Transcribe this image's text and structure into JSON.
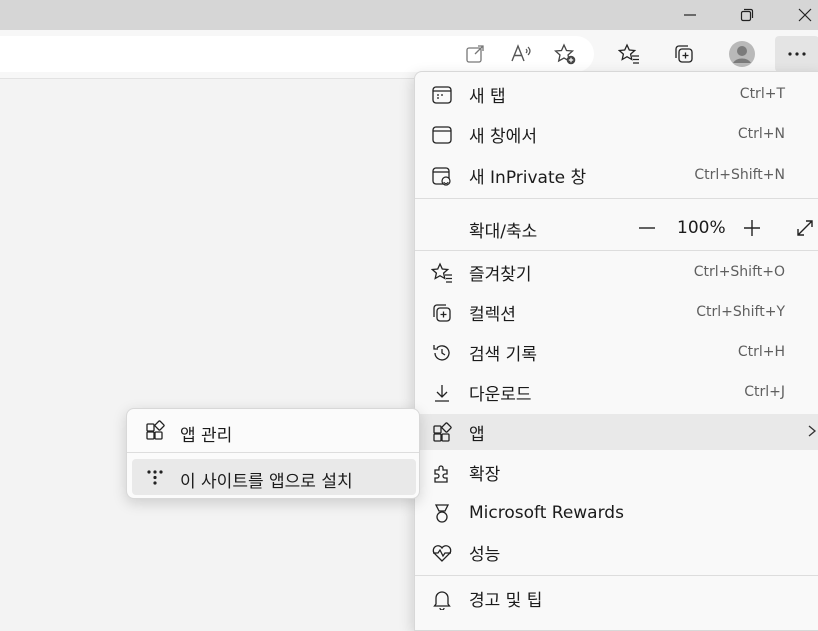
{
  "window": {
    "minimize_icon": "minimize-icon",
    "restore_icon": "restore-icon",
    "close_icon": "close-icon"
  },
  "toolbar": {
    "icons": [
      "open-in-app-icon",
      "read-aloud-icon",
      "add-favorite-icon",
      "favorites-icon",
      "collections-icon",
      "profile-avatar",
      "more-icon"
    ]
  },
  "menu": {
    "new_tab": {
      "label": "새 탭",
      "shortcut": "Ctrl+T"
    },
    "new_window": {
      "label": "새 창에서",
      "shortcut": "Ctrl+N"
    },
    "new_inprivate": {
      "label": "새 InPrivate 창",
      "shortcut": "Ctrl+Shift+N"
    },
    "zoom": {
      "label": "확대/축소",
      "value": "100%",
      "minus": "—",
      "plus": "+"
    },
    "favorites": {
      "label": "즐겨찾기",
      "shortcut": "Ctrl+Shift+O"
    },
    "collections": {
      "label": "컬렉션",
      "shortcut": "Ctrl+Shift+Y"
    },
    "history": {
      "label": "검색 기록",
      "shortcut": "Ctrl+H"
    },
    "downloads": {
      "label": "다운로드",
      "shortcut": "Ctrl+J"
    },
    "apps": {
      "label": "앱"
    },
    "extensions": {
      "label": "확장"
    },
    "rewards": {
      "label": "Microsoft Rewards"
    },
    "performance": {
      "label": "성능"
    },
    "alerts": {
      "label": "경고 및 팁"
    }
  },
  "submenu": {
    "manage_apps": {
      "label": "앱 관리"
    },
    "install_site": {
      "label": "이 사이트를 앱으로 설치"
    }
  },
  "colors": {
    "titlebar": "#d6d6d6",
    "menu_bg": "#f9f9f9",
    "hover_bg": "#e9e9e9"
  }
}
